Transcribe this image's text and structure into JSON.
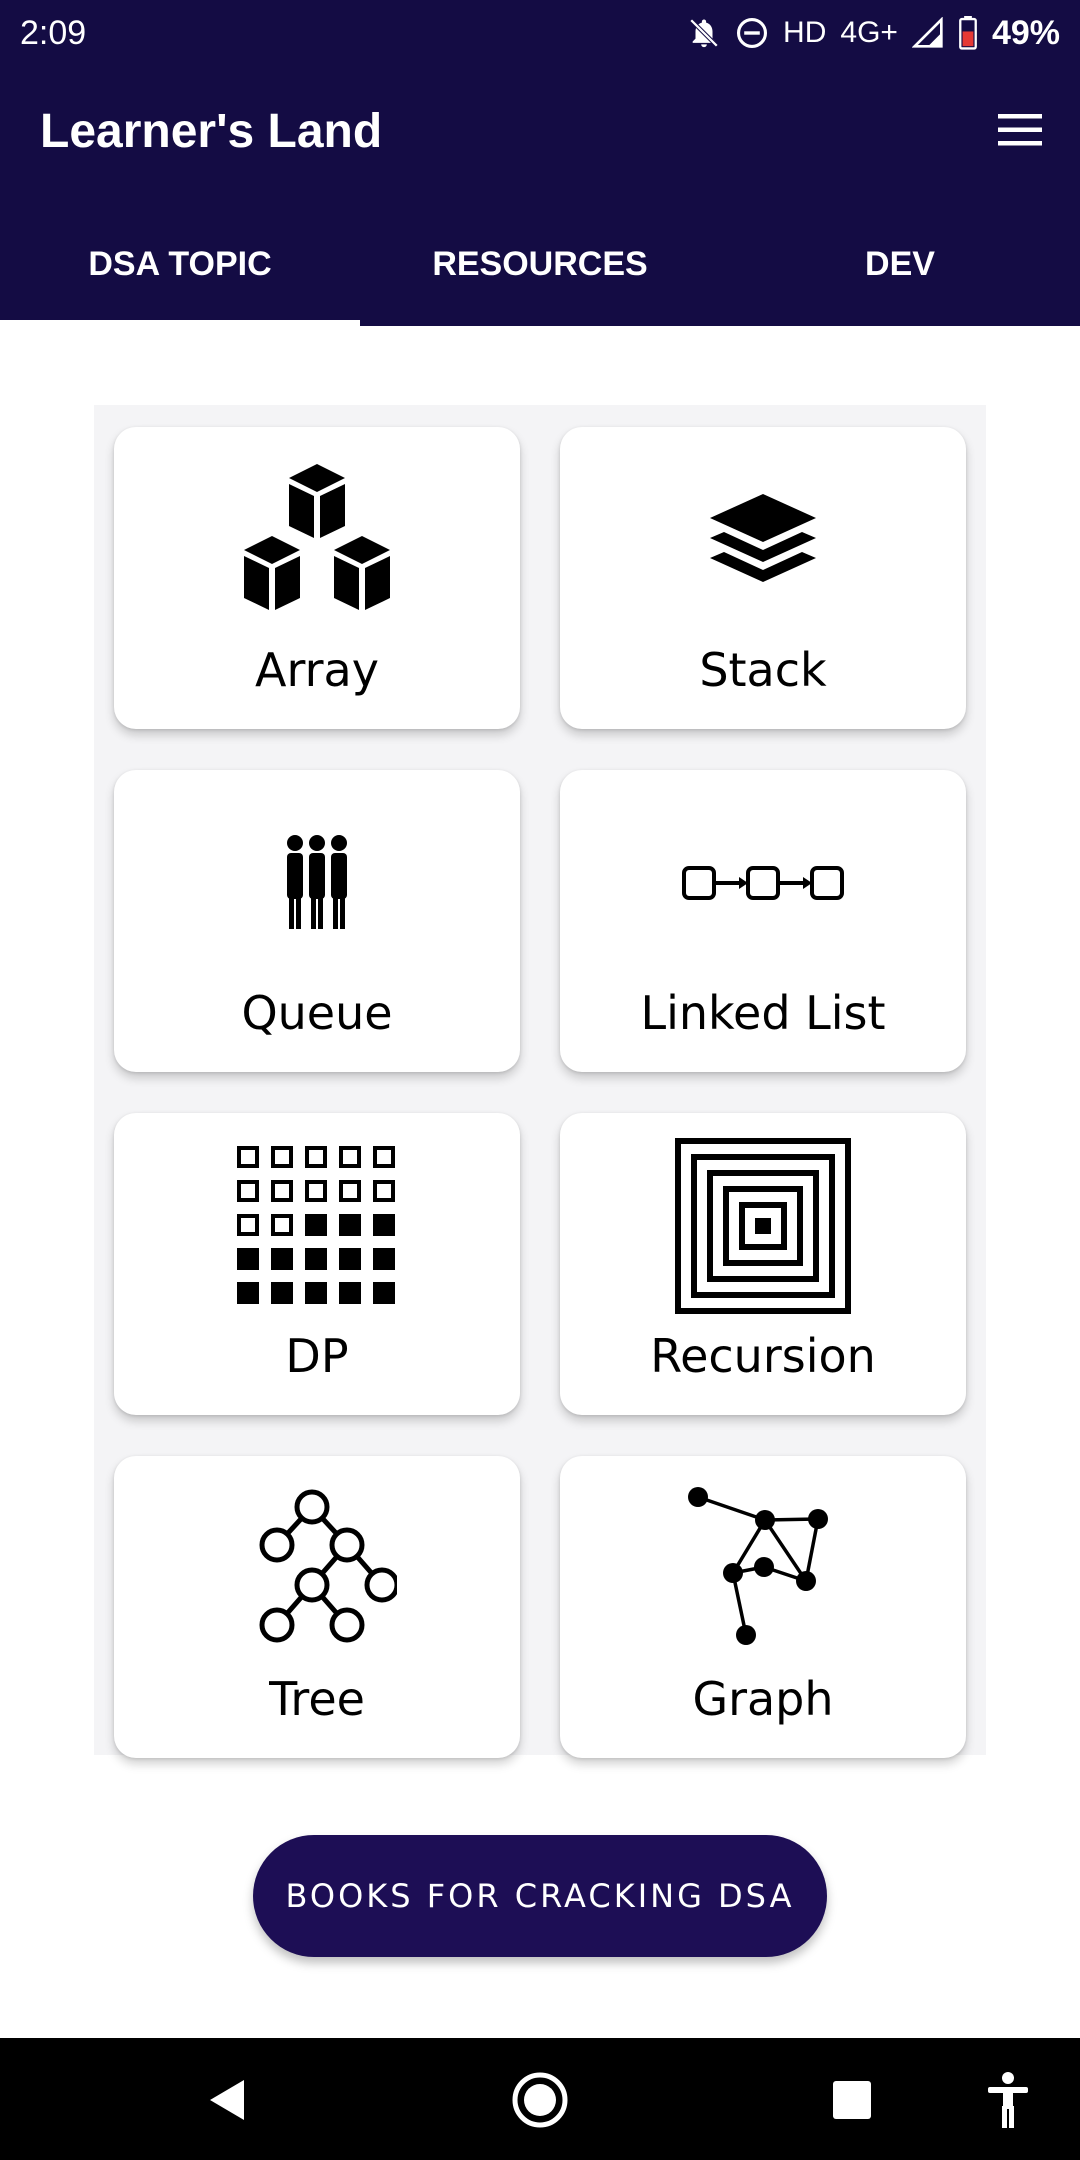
{
  "status_bar": {
    "time": "2:09",
    "network_label": "HD",
    "network_type": "4G+",
    "battery_percent": "49%",
    "icons": [
      "bell-off-icon",
      "do-not-disturb-icon",
      "signal-icon",
      "battery-icon"
    ]
  },
  "app_bar": {
    "title": "Learner's Land",
    "menu_icon": "hamburger-menu-icon"
  },
  "tabs": [
    {
      "label": "DSA TOPIC",
      "active": true
    },
    {
      "label": "RESOURCES",
      "active": false
    },
    {
      "label": "DEV",
      "active": false
    }
  ],
  "topics": [
    {
      "label": "Array",
      "icon": "cubes-icon"
    },
    {
      "label": "Stack",
      "icon": "layers-icon"
    },
    {
      "label": "Queue",
      "icon": "people-queue-icon"
    },
    {
      "label": "Linked List",
      "icon": "linked-nodes-icon"
    },
    {
      "label": "DP",
      "icon": "dp-grid-icon"
    },
    {
      "label": "Recursion",
      "icon": "nested-squares-icon"
    },
    {
      "label": "Tree",
      "icon": "tree-icon"
    },
    {
      "label": "Graph",
      "icon": "graph-icon"
    }
  ],
  "books_button": {
    "label": "BOOKS FOR CRACKING DSA"
  },
  "nav_bar": {
    "buttons": [
      "back-icon",
      "home-icon",
      "recents-icon",
      "accessibility-icon"
    ]
  },
  "colors": {
    "primary": "#140c44",
    "button": "#1d0e55",
    "background": "#ffffff"
  }
}
